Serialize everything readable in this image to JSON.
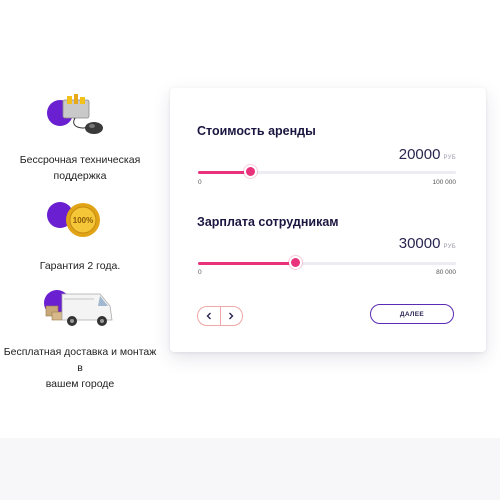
{
  "features": [
    {
      "caption_line1": "Бессрочная техническая",
      "caption_line2": "поддержка",
      "icon": "toolbox-mouse-icon"
    },
    {
      "caption_line1": "Гарантия 2 года.",
      "caption_line2": "",
      "icon": "guarantee-medal-icon",
      "badge_text": "100%"
    },
    {
      "caption_line1": "Бесплатная доставка и монтаж в",
      "caption_line2": "вашем городе",
      "icon": "delivery-van-icon"
    }
  ],
  "calculator": {
    "rent": {
      "title": "Стоимость аренды",
      "value": "20000",
      "unit": "РУБ",
      "min_label": "0",
      "max_label": "100 000",
      "level": 0.2
    },
    "salary": {
      "title": "Зарплата сотрудникам",
      "value": "30000",
      "unit": "РУБ",
      "min_label": "0",
      "max_label": "80 000",
      "level": 0.375
    },
    "next_label": "ДАЛЕЕ"
  },
  "colors": {
    "accent_pink": "#e8327c",
    "accent_purple": "#6a1fd0",
    "button_border": "#5b2bb8",
    "text_dark": "#1b1640"
  }
}
